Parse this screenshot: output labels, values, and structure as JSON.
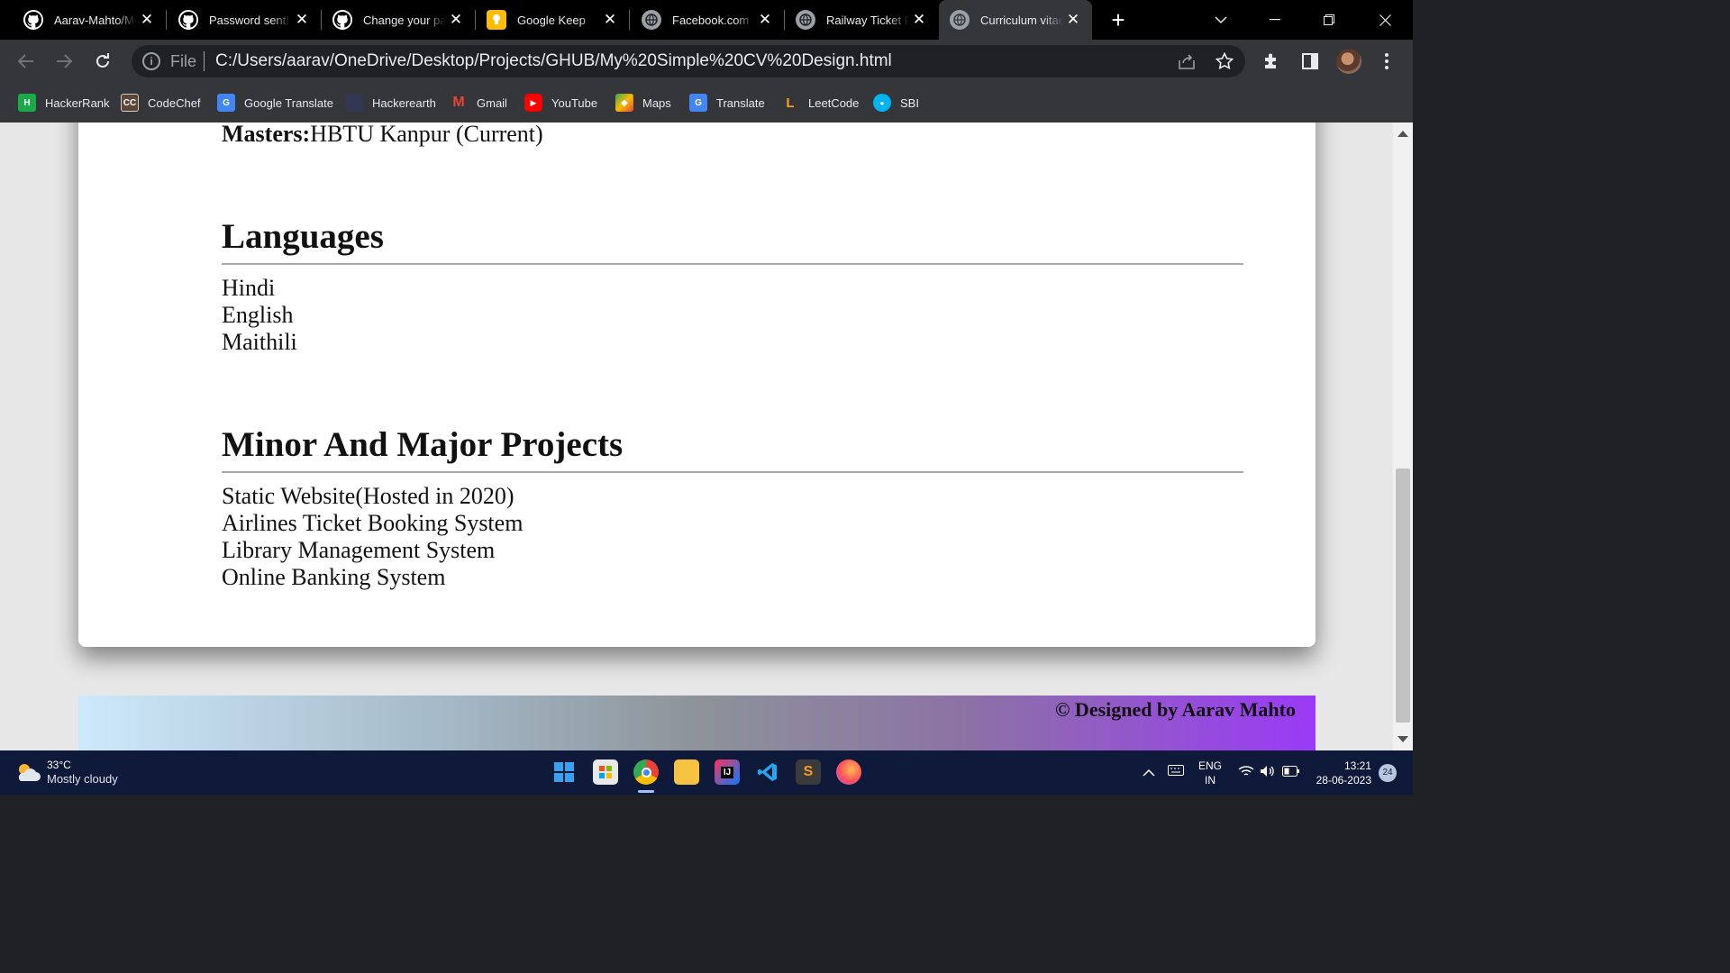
{
  "browser": {
    "tabs": [
      {
        "title": "Aarav-Mahto/My Simple CV Design",
        "icon": "github-icon",
        "active": false
      },
      {
        "title": "Password sent! · GitHub",
        "icon": "github-icon",
        "active": false
      },
      {
        "title": "Change your password",
        "icon": "github-icon",
        "active": false
      },
      {
        "title": "Google Keep",
        "icon": "keep-icon",
        "active": false
      },
      {
        "title": "Facebook.com",
        "icon": "globe-icon",
        "active": false
      },
      {
        "title": "Railway Ticket Reservation",
        "icon": "globe-icon",
        "active": false
      },
      {
        "title": "Curriculum vitae",
        "icon": "globe-icon",
        "active": true
      }
    ],
    "new_tab_symbol": "+",
    "omnibox": {
      "scheme_label": "File",
      "url": "C:/Users/aarav/OneDrive/Desktop/Projects/GHUB/My%20Simple%20CV%20Design.html"
    },
    "bookmarks": [
      {
        "label": "HackerRank",
        "icon": "hackerrank-icon",
        "color": "#1ba94c",
        "glyph": "H"
      },
      {
        "label": "CodeChef",
        "icon": "codechef-icon",
        "color": "#5b4638",
        "glyph": "CC"
      },
      {
        "label": "Google Translate",
        "icon": "google-translate-icon",
        "color": "#4285f4",
        "glyph": "G"
      },
      {
        "label": "Hackerearth",
        "icon": "hackerearth-icon",
        "color": "#323754",
        "glyph": ""
      },
      {
        "label": "Gmail",
        "icon": "gmail-icon",
        "color": "#ea4335",
        "glyph": "M"
      },
      {
        "label": "YouTube",
        "icon": "youtube-icon",
        "color": "#ff0000",
        "glyph": "▶"
      },
      {
        "label": "Maps",
        "icon": "maps-icon",
        "color": "#34a853",
        "glyph": "◆"
      },
      {
        "label": "Translate",
        "icon": "translate-icon",
        "color": "#4285f4",
        "glyph": "G"
      },
      {
        "label": "LeetCode",
        "icon": "leetcode-icon",
        "color": "#ffa116",
        "glyph": "L"
      },
      {
        "label": "SBI",
        "icon": "sbi-icon",
        "color": "#00b5ef",
        "glyph": "●"
      }
    ]
  },
  "page": {
    "masters_label": "Masters:",
    "masters_value": "HBTU Kanpur (Current)",
    "languages_heading": "Languages",
    "languages": [
      "Hindi",
      "English",
      "Maithili"
    ],
    "projects_heading": "Minor And Major Projects",
    "projects": [
      "Static Website(Hosted in 2020)",
      "Airlines Ticket Booking System",
      "Library Management System",
      "Online Banking System"
    ],
    "footer": "© Designed by Aarav Mahto",
    "footer_gradient": [
      "#cde9fb",
      "#9a3af7"
    ]
  },
  "taskbar": {
    "weather_temp": "33°C",
    "weather_desc": "Mostly cloudy",
    "lang_top": "ENG",
    "lang_bottom": "IN",
    "time": "13:21",
    "date": "28-06-2023",
    "notification_count": "24"
  }
}
